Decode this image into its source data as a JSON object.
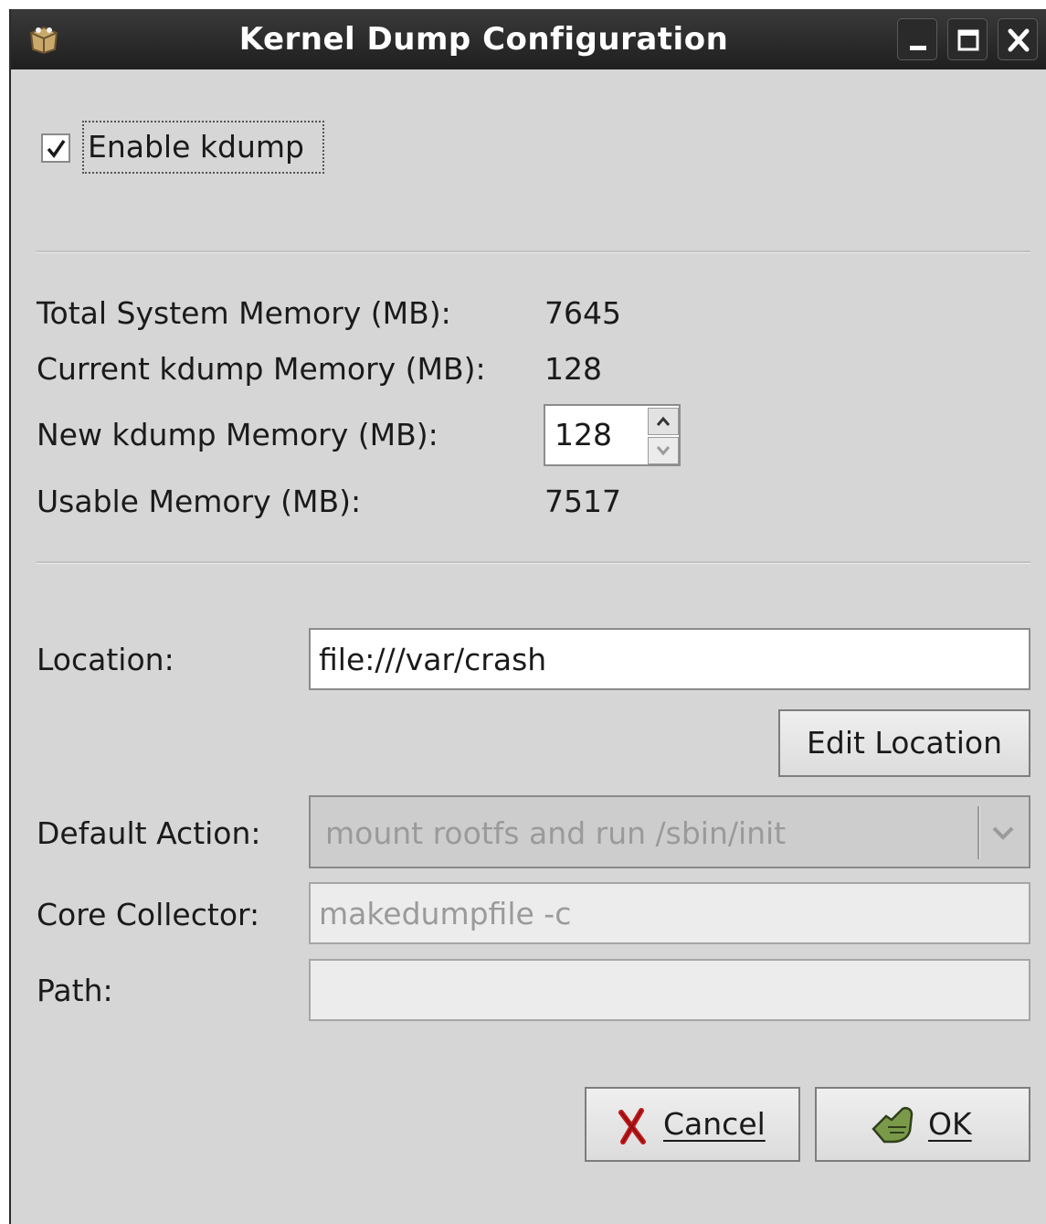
{
  "window": {
    "title": "Kernel Dump Configuration",
    "controls": [
      "minimize",
      "maximize",
      "close"
    ]
  },
  "enable_kdump": {
    "label": "Enable kdump",
    "checked": true
  },
  "memory": {
    "total_label": "Total System Memory (MB):",
    "total_value": "7645",
    "current_label": "Current kdump Memory (MB):",
    "current_value": "128",
    "new_label": "New kdump Memory (MB):",
    "new_value": "128",
    "usable_label": "Usable Memory (MB):",
    "usable_value": "7517"
  },
  "location": {
    "label": "Location:",
    "value": "file:///var/crash",
    "edit_button": "Edit Location"
  },
  "default_action": {
    "label": "Default Action:",
    "selected": "mount rootfs and run /sbin/init"
  },
  "core_collector": {
    "label": "Core Collector:",
    "value": "makedumpfile -c"
  },
  "path": {
    "label": "Path:",
    "value": ""
  },
  "buttons": {
    "cancel_label": "Cancel",
    "ok_label": "OK"
  },
  "colors": {
    "window_bg": "#d6d6d6",
    "titlebar_bg": "#1f1f1f",
    "cancel_icon": "#c0181b",
    "ok_icon": "#7a9a4a"
  }
}
